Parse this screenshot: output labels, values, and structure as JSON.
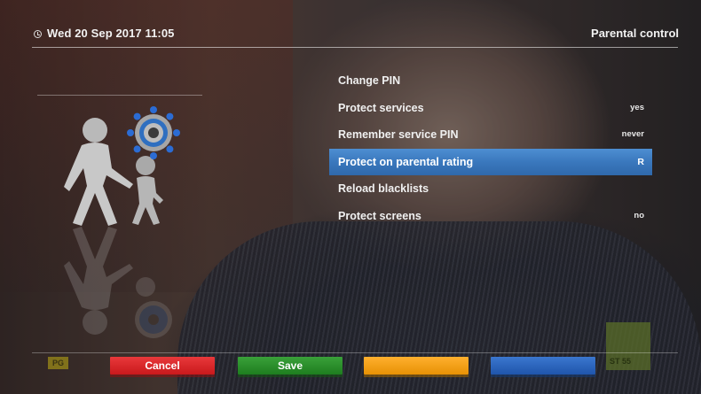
{
  "header": {
    "datetime": "Wed 20 Sep 2017  11:05",
    "title": "Parental control",
    "clock_icon": "clock-icon"
  },
  "menu": {
    "items": [
      {
        "label": "Change PIN",
        "value": ""
      },
      {
        "label": "Protect services",
        "value": "yes"
      },
      {
        "label": "Remember service PIN",
        "value": "never"
      },
      {
        "label": "Protect on parental rating",
        "value": "R",
        "selected": true
      },
      {
        "label": "Reload blacklists",
        "value": ""
      },
      {
        "label": "Protect screens",
        "value": "no"
      }
    ]
  },
  "footer": {
    "rating_badge": "PG",
    "buttons": {
      "red": "Cancel",
      "green": "Save",
      "yellow": "",
      "blue": ""
    },
    "info_box": "ST 55"
  },
  "colors": {
    "selection": "#3a78bd",
    "red_button": "#d6262a",
    "green_button": "#2a8c2b",
    "yellow_button": "#f2a20f",
    "blue_button": "#2a62ba"
  },
  "illustration": {
    "icons": [
      "parent-child-icon",
      "gear-icon"
    ]
  }
}
